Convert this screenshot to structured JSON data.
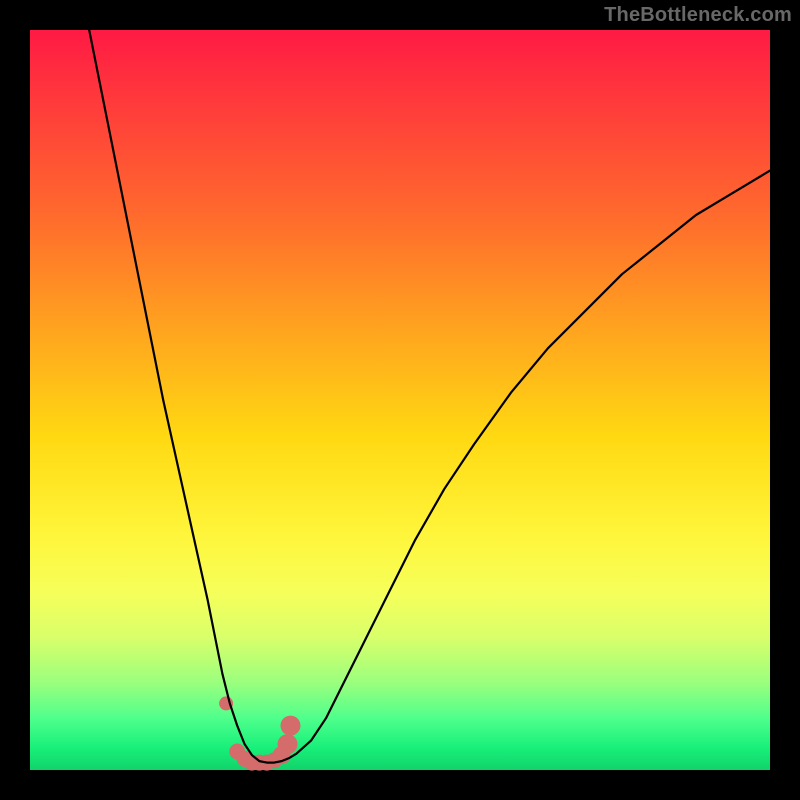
{
  "watermark": "TheBottleneck.com",
  "chart_data": {
    "type": "line",
    "title": "",
    "xlabel": "",
    "ylabel": "",
    "xlim": [
      0,
      100
    ],
    "ylim": [
      0,
      100
    ],
    "series": [
      {
        "name": "bottleneck-curve",
        "x": [
          8,
          10,
          12,
          14,
          16,
          18,
          20,
          22,
          24,
          25,
          26,
          27,
          28,
          29,
          30,
          31,
          32,
          33,
          34,
          35,
          36,
          38,
          40,
          42,
          45,
          48,
          52,
          56,
          60,
          65,
          70,
          75,
          80,
          85,
          90,
          95,
          100
        ],
        "y": [
          100,
          90,
          80,
          70,
          60,
          50,
          41,
          32,
          23,
          18,
          13,
          9,
          6,
          3.5,
          2,
          1.2,
          1,
          1,
          1.2,
          1.6,
          2.2,
          4,
          7,
          11,
          17,
          23,
          31,
          38,
          44,
          51,
          57,
          62,
          67,
          71,
          75,
          78,
          81
        ]
      }
    ],
    "markers": {
      "name": "highlight-dots",
      "color": "#d46c6c",
      "points_x": [
        26.5,
        28,
        29,
        30,
        31,
        32,
        33,
        34,
        34.8,
        35.2
      ],
      "points_y": [
        9,
        2.5,
        1.5,
        1,
        1,
        1,
        1.3,
        2,
        3.5,
        6
      ],
      "radii": [
        7,
        8,
        8,
        8,
        8,
        8,
        8,
        9,
        10,
        10
      ]
    }
  }
}
